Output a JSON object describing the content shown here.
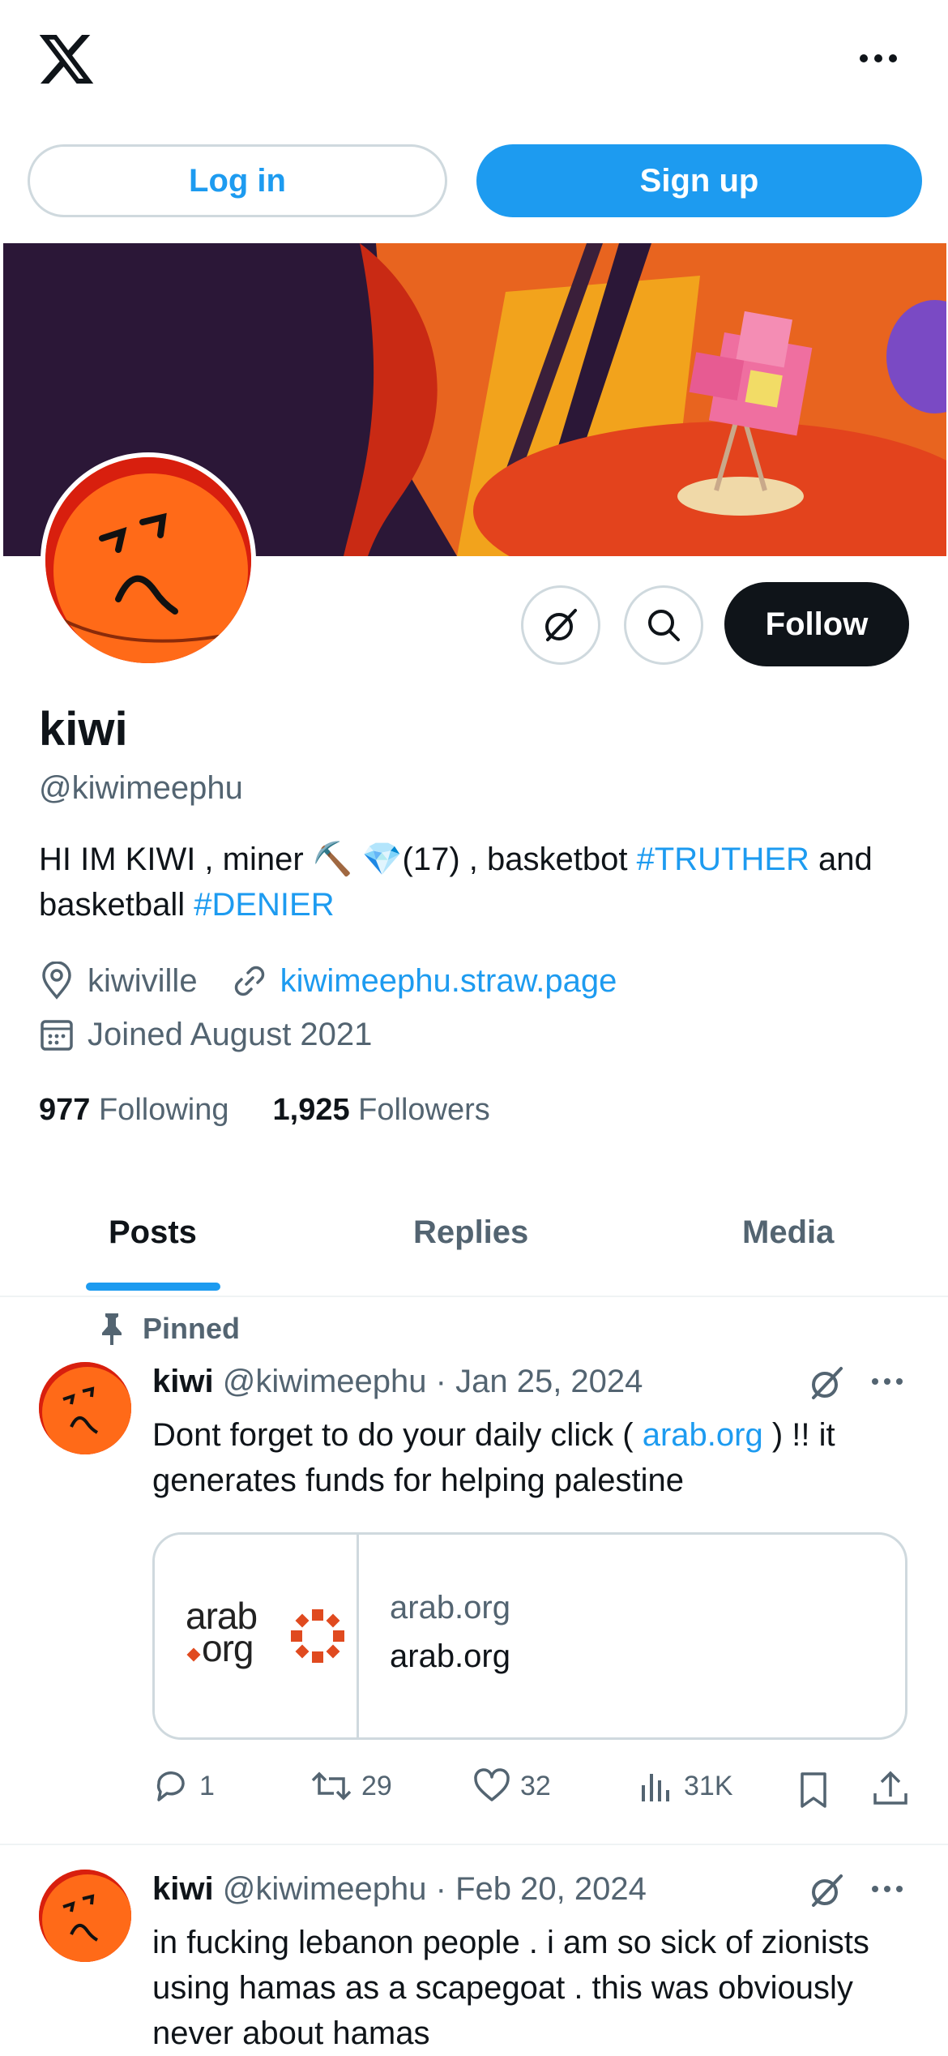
{
  "header": {
    "login_label": "Log in",
    "signup_label": "Sign up"
  },
  "profile": {
    "name": "kiwi",
    "handle": "@kiwimeephu",
    "bio_part1": "HI IM KIWI , miner ⛏️ 💎(17) , basketbot ",
    "bio_tag1": "#TRUTHER",
    "bio_part2": " and basketball ",
    "bio_tag2": "#DENIER",
    "location": "kiwiville",
    "website": "kiwimeephu.straw.page",
    "joined": "Joined August 2021",
    "following_count": "977",
    "following_label": "Following",
    "followers_count": "1,925",
    "followers_label": "Followers",
    "follow_label": "Follow"
  },
  "tabs": [
    {
      "label": "Posts",
      "active": true
    },
    {
      "label": "Replies",
      "active": false
    },
    {
      "label": "Media",
      "active": false
    }
  ],
  "posts": [
    {
      "pinned_label": "Pinned",
      "author": "kiwi",
      "handle": "@kiwimeephu",
      "date": "· Jan 25, 2024",
      "text_part1": "Dont forget to do your daily click ( ",
      "text_link": "arab.org",
      "text_part2": " ) !! it generates funds for helping palestine",
      "card": {
        "domain": "arab.org",
        "title": "arab.org",
        "logo_line1": "arab",
        "logo_line2": "org"
      },
      "replies": "1",
      "reposts": "29",
      "likes": "32",
      "views": "31K"
    },
    {
      "author": "kiwi",
      "handle": "@kiwimeephu",
      "date": "· Feb 20, 2024",
      "text": "in fucking lebanon people . i am so sick of zionists using hamas as a scapegoat . this was obviously never about hamas"
    }
  ],
  "colors": {
    "accent": "#1d9bf0",
    "text": "#0f1419",
    "muted": "#536471",
    "border": "#cfd9de"
  }
}
